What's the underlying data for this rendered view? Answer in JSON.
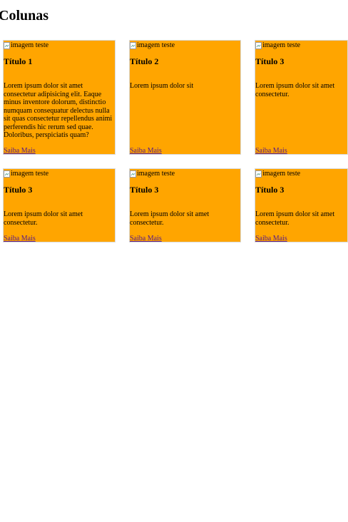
{
  "page": {
    "title": "Colunas"
  },
  "cards": [
    {
      "image_alt": "imagem teste",
      "title": "Título 1",
      "text": "Lorem ipsum dolor sit amet consectetur adipisicing elit. Eaque minus inventore dolorum, distinctio numquam consequatur delectus nulla sit quas consectetur repellendus animi perferendis hic rerum sed quae. Doloribus, perspiciatis quam?",
      "link_label": "Saiba Mais"
    },
    {
      "image_alt": "imagem teste",
      "title": "Título 2",
      "text": "Lorem ipsum dolor sit",
      "link_label": "Saiba Mais"
    },
    {
      "image_alt": "imagem teste",
      "title": "Título 3",
      "text": "Lorem ipsum dolor sit amet consectetur.",
      "link_label": "Saiba Mais"
    },
    {
      "image_alt": "imagem teste",
      "title": "Título 3",
      "text": "Lorem ipsum dolor sit amet consectetur.",
      "link_label": "Saiba Mais"
    },
    {
      "image_alt": "imagem teste",
      "title": "Título 3",
      "text": "Lorem ipsum dolor sit amet consectetur.",
      "link_label": "Saiba Mais"
    },
    {
      "image_alt": "imagem teste",
      "title": "Título 3",
      "text": "Lorem ipsum dolor sit amet consectetur.",
      "link_label": "Saiba Mais"
    }
  ],
  "colors": {
    "card_background": "#ffa500",
    "link": "#551a8b",
    "page_background": "#ffffff"
  },
  "icons": {
    "image_placeholder": "broken-image-icon"
  }
}
